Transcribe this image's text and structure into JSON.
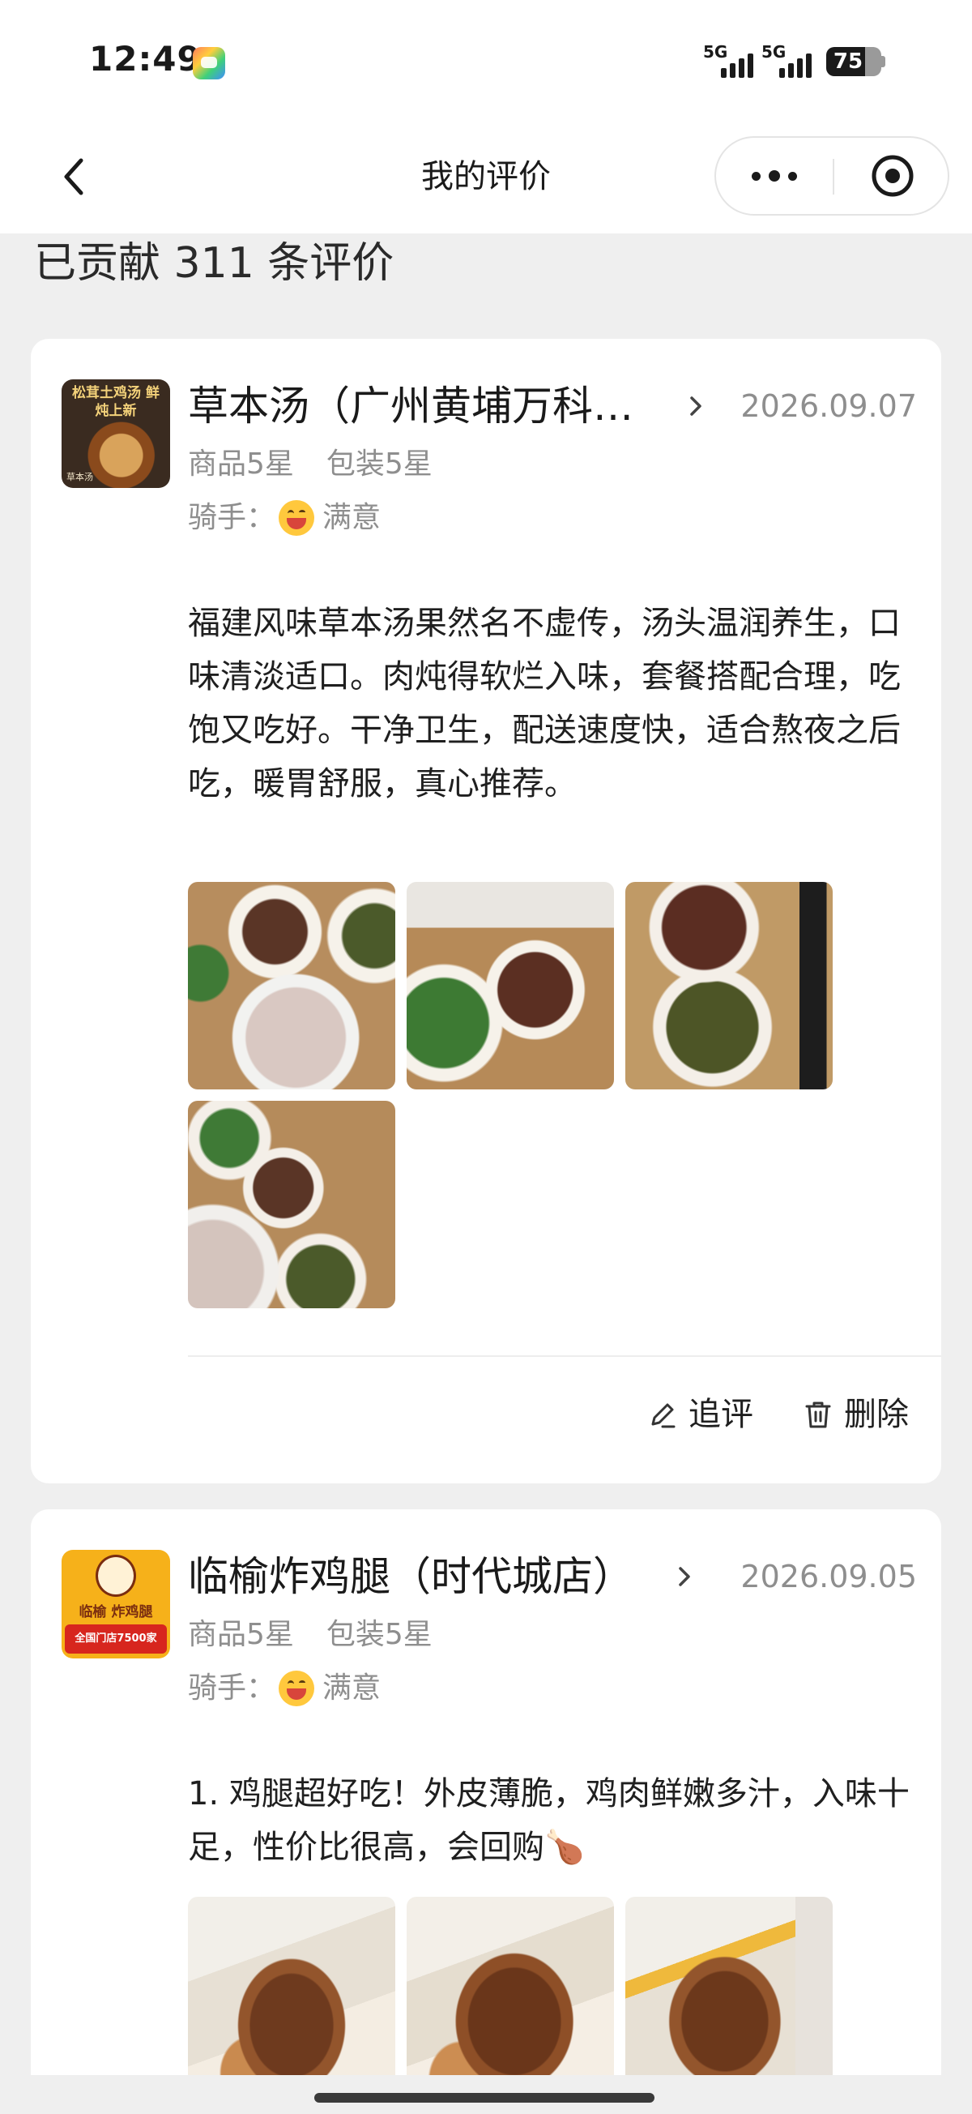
{
  "status_bar": {
    "time": "12:49",
    "network_1": "5G",
    "network_2": "5G",
    "battery": "75"
  },
  "nav": {
    "title": "我的评价"
  },
  "summary": "已贡献 311 条评价",
  "reviews": [
    {
      "shop_name": "草本汤（广州黄埔万科…",
      "date": "2026.09.07",
      "product_rating": "商品5星",
      "package_rating": "包装5星",
      "rider_label": "骑手：",
      "rider_rating": "满意",
      "text": "福建风味草本汤果然名不虚传，汤头温润养生，口味清淡适口。肉炖得软烂入味，套餐搭配合理，吃饱又吃好。干净卫生，配送速度快，适合熬夜之后吃，暖胃舒服，真心推荐。",
      "logo_text_top": "松茸土鸡汤 鲜炖上新",
      "logo_text_bottom": "草本汤",
      "photo_count": 4,
      "follow_up_label": "追评",
      "delete_label": "删除"
    },
    {
      "shop_name": "临榆炸鸡腿（时代城店）",
      "date": "2026.09.05",
      "product_rating": "商品5星",
      "package_rating": "包装5星",
      "rider_label": "骑手：",
      "rider_rating": "满意",
      "text": "1. 鸡腿超好吃！外皮薄脆，鸡肉鲜嫩多汁，入味十足，性价比很高，会回购🍗",
      "logo_text_top": "临榆 炸鸡腿",
      "logo_text_bottom": "全国门店7500家",
      "photo_count": 3
    }
  ],
  "colors": {
    "page_bg": "#efefef",
    "card_bg": "#ffffff",
    "muted_text": "#8e8e8e",
    "primary_text": "#1a1a1a"
  },
  "icons": [
    "back-arrow-icon",
    "more-dots-icon",
    "close-target-icon",
    "chevron-right-icon",
    "edit-pen-icon",
    "trash-icon",
    "grinning-face-icon"
  ]
}
